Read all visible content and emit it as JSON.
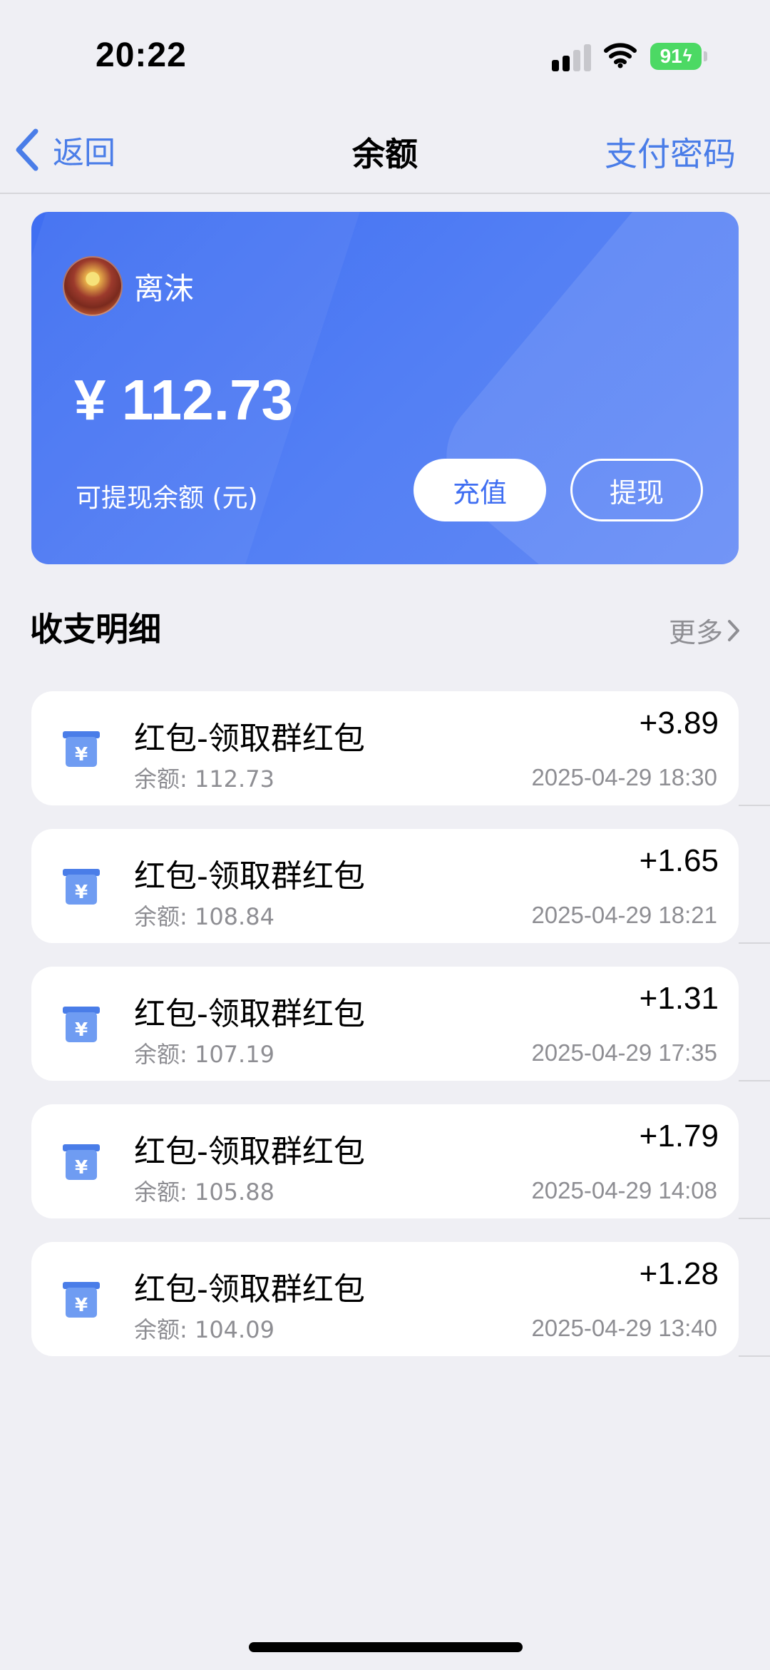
{
  "status_bar": {
    "time": "20:22",
    "battery": "91"
  },
  "nav": {
    "back_label": "返回",
    "title": "余额",
    "right_label": "支付密码"
  },
  "card": {
    "username": "离沫",
    "amount": "¥ 112.73",
    "balance_label": "可提现余额 (元)",
    "recharge_label": "充值",
    "withdraw_label": "提现"
  },
  "section": {
    "title": "收支明细",
    "more_label": "更多"
  },
  "transactions": [
    {
      "title": "红包-领取群红包",
      "balance": "余额: 112.73",
      "amount": "+3.89",
      "time": "2025-04-29 18:30"
    },
    {
      "title": "红包-领取群红包",
      "balance": "余额: 108.84",
      "amount": "+1.65",
      "time": "2025-04-29 18:21"
    },
    {
      "title": "红包-领取群红包",
      "balance": "余额: 107.19",
      "amount": "+1.31",
      "time": "2025-04-29 17:35"
    },
    {
      "title": "红包-领取群红包",
      "balance": "余额: 105.88",
      "amount": "+1.79",
      "time": "2025-04-29 14:08"
    },
    {
      "title": "红包-领取群红包",
      "balance": "余额: 104.09",
      "amount": "+1.28",
      "time": "2025-04-29 13:40"
    }
  ],
  "colors": {
    "accent": "#4a7de8",
    "card_start": "#3f6ef2",
    "card_end": "#6289f5",
    "background": "#efeff4",
    "battery": "#4cd964"
  },
  "icons": {
    "back": "chevron-left-icon",
    "more": "chevron-right-icon",
    "transaction": "wallet-yen-icon",
    "signal": "signal-icon",
    "wifi": "wifi-icon",
    "battery": "battery-icon"
  }
}
